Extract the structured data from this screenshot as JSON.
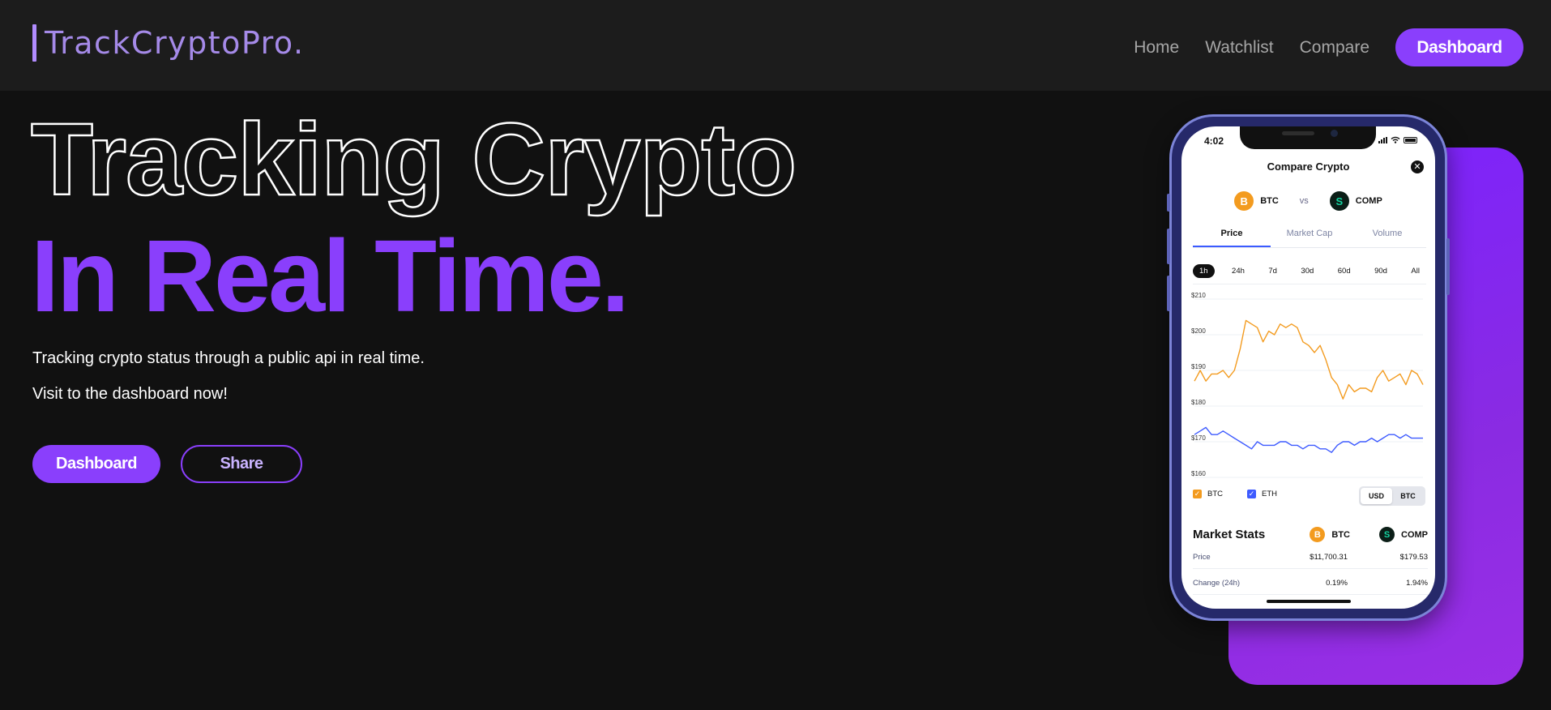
{
  "nav": {
    "logo": "TrackCryptoPro.",
    "links": [
      "Home",
      "Watchlist",
      "Compare"
    ],
    "dashboard_label": "Dashboard"
  },
  "hero": {
    "line1": "Tracking Crypto",
    "line2": "In Real Time.",
    "description": "Tracking crypto status through a public api in real time.",
    "cta_text": "Visit to the dashboard now!",
    "dashboard_button": "Dashboard",
    "share_button": "Share"
  },
  "colors": {
    "accent": "#8a3ffc",
    "background": "#111111",
    "navbar": "#1c1c1c",
    "btc": "#f39b1f",
    "eth": "#3e5bff"
  },
  "phone": {
    "time": "4:02",
    "title": "Compare Crypto",
    "coin1": "BTC",
    "coin1_icon": "B",
    "vs": "vs",
    "coin2": "COMP",
    "coin2_icon": "S",
    "tabs": [
      "Price",
      "Market Cap",
      "Volume"
    ],
    "ranges": [
      "1h",
      "24h",
      "7d",
      "30d",
      "60d",
      "90d",
      "All"
    ],
    "chart_y_labels": [
      "$210",
      "$200",
      "$190",
      "$180",
      "$170",
      "$160"
    ],
    "legend": [
      "BTC",
      "ETH"
    ],
    "currency_toggle": [
      "USD",
      "BTC"
    ],
    "market_stats_title": "Market Stats",
    "stats": [
      {
        "label": "Price",
        "btc": "$11,700.31",
        "comp": "$179.53"
      },
      {
        "label": "Change (24h)",
        "btc": "0.19%",
        "comp": "1.94%"
      }
    ]
  },
  "chart_data": {
    "type": "line",
    "ylim": [
      160,
      210
    ],
    "x": [
      0,
      1,
      2,
      3,
      4,
      5,
      6,
      7,
      8,
      9,
      10,
      11,
      12,
      13,
      14,
      15,
      16,
      17,
      18,
      19,
      20,
      21,
      22,
      23,
      24,
      25,
      26,
      27,
      28,
      29,
      30,
      31,
      32,
      33,
      34,
      35,
      36,
      37,
      38,
      39,
      40
    ],
    "series": [
      {
        "name": "BTC",
        "color": "#f39b1f",
        "values": [
          187,
          190,
          187,
          189,
          189,
          190,
          188,
          190,
          196,
          204,
          203,
          202,
          198,
          201,
          200,
          203,
          202,
          203,
          202,
          198,
          197,
          195,
          197,
          193,
          188,
          186,
          182,
          186,
          184,
          185,
          185,
          184,
          188,
          190,
          187,
          188,
          189,
          186,
          190,
          189,
          186
        ]
      },
      {
        "name": "ETH",
        "color": "#3e5bff",
        "values": [
          172,
          173,
          174,
          172,
          172,
          173,
          172,
          171,
          170,
          169,
          168,
          170,
          169,
          169,
          169,
          170,
          170,
          169,
          169,
          168,
          169,
          169,
          168,
          168,
          167,
          169,
          170,
          170,
          169,
          170,
          170,
          171,
          170,
          171,
          172,
          172,
          171,
          172,
          171,
          171,
          171
        ]
      }
    ]
  }
}
